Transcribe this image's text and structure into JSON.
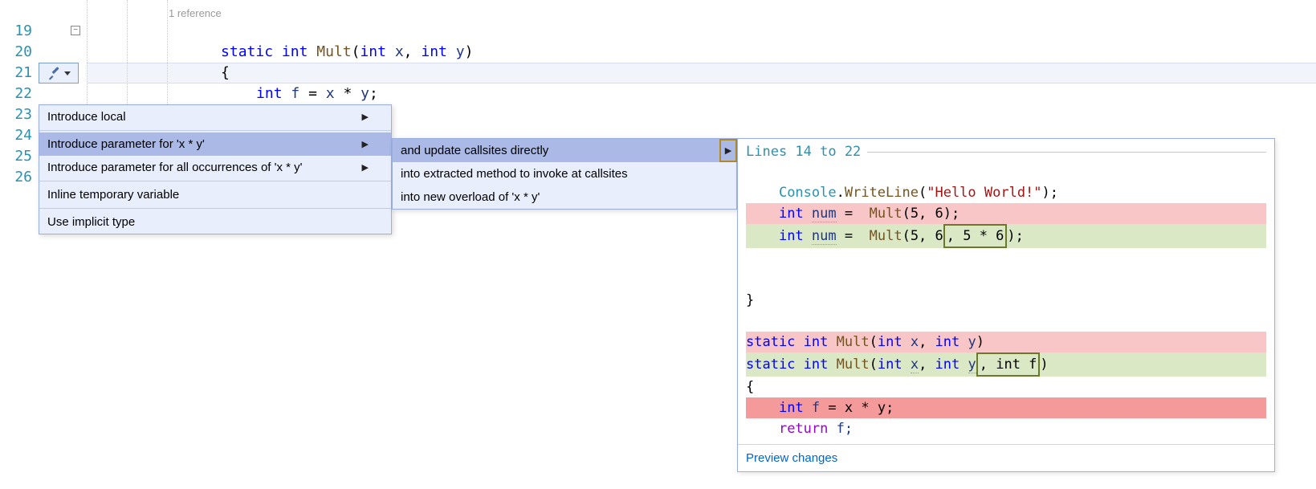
{
  "editor": {
    "codelens": "1 reference",
    "lines": {
      "19": 19,
      "20": 20,
      "21": 21,
      "22": 22,
      "23": 23,
      "24": 24,
      "25": 25,
      "26": 26
    },
    "code": {
      "l19_static": "static",
      "l19_int": "int",
      "l19_mult": "Mult",
      "l19_paren_open": "(",
      "l19_intx": "int",
      "l19_x": "x",
      "l19_comma": ",",
      "l19_inty": "int",
      "l19_y": "y",
      "l19_paren_close": ")",
      "l20_brace": "{",
      "l21_int": "int",
      "l21_f": "f",
      "l21_eq": "=",
      "l21_x": "x",
      "l21_star": "*",
      "l21_y": "y",
      "l21_semi": ";"
    }
  },
  "menu1": {
    "items": [
      {
        "label": "Introduce local",
        "submenu": true,
        "selected": false
      },
      {
        "label": "Introduce parameter for 'x * y'",
        "submenu": true,
        "selected": true
      },
      {
        "label": "Introduce parameter for all occurrences of 'x * y'",
        "submenu": true,
        "selected": false
      },
      {
        "label": "Inline temporary variable",
        "submenu": false,
        "selected": false
      },
      {
        "label": "Use implicit type",
        "submenu": false,
        "selected": false
      }
    ]
  },
  "menu2": {
    "items": [
      {
        "label": "and update callsites directly",
        "submenu": true,
        "selected": true
      },
      {
        "label": "into extracted method to invoke at callsites",
        "submenu": false,
        "selected": false
      },
      {
        "label": "into new overload of 'x * y'",
        "submenu": false,
        "selected": false
      }
    ]
  },
  "preview": {
    "header": "Lines 14 to 22",
    "footer": "Preview changes",
    "code": {
      "l1_console": "Console",
      "l1_dot": ".",
      "l1_writeline": "WriteLine",
      "l1_open": "(",
      "l1_str": "\"Hello World!\"",
      "l1_close": ");",
      "l2_int": "int",
      "l2_num": "num",
      "l2_eq": "=",
      "l2_mult": "Mult",
      "l2_args": "(5, 6);",
      "l3_int": "int",
      "l3_num": "num",
      "l3_eq": "=",
      "l3_mult": "Mult",
      "l3_args_a": "(5, 6",
      "l3_args_b": ", 5 * 6",
      "l3_args_c": ");",
      "l4_blank": "",
      "l5_brace": "}",
      "l6_blank": "",
      "l7_static": "static",
      "l7_int": "int",
      "l7_mult": "Mult",
      "l7_sig": "(",
      "l7_intx": "int",
      "l7_x": "x",
      "l7_c1": ", ",
      "l7_inty": "int",
      "l7_y": "y",
      "l7_close": ")",
      "l8_static": "static",
      "l8_int": "int",
      "l8_mult": "Mult",
      "l8_sig": "(",
      "l8_intx": "int",
      "l8_x": "x",
      "l8_c1": ", ",
      "l8_inty": "int",
      "l8_y": "y",
      "l8_box": ", int f",
      "l8_close": ")",
      "l9_brace": "{",
      "l10_int": "int",
      "l10_f": "f",
      "l10_eq": "= x * y;",
      "l11_return": "return",
      "l11_f": "f;"
    }
  }
}
